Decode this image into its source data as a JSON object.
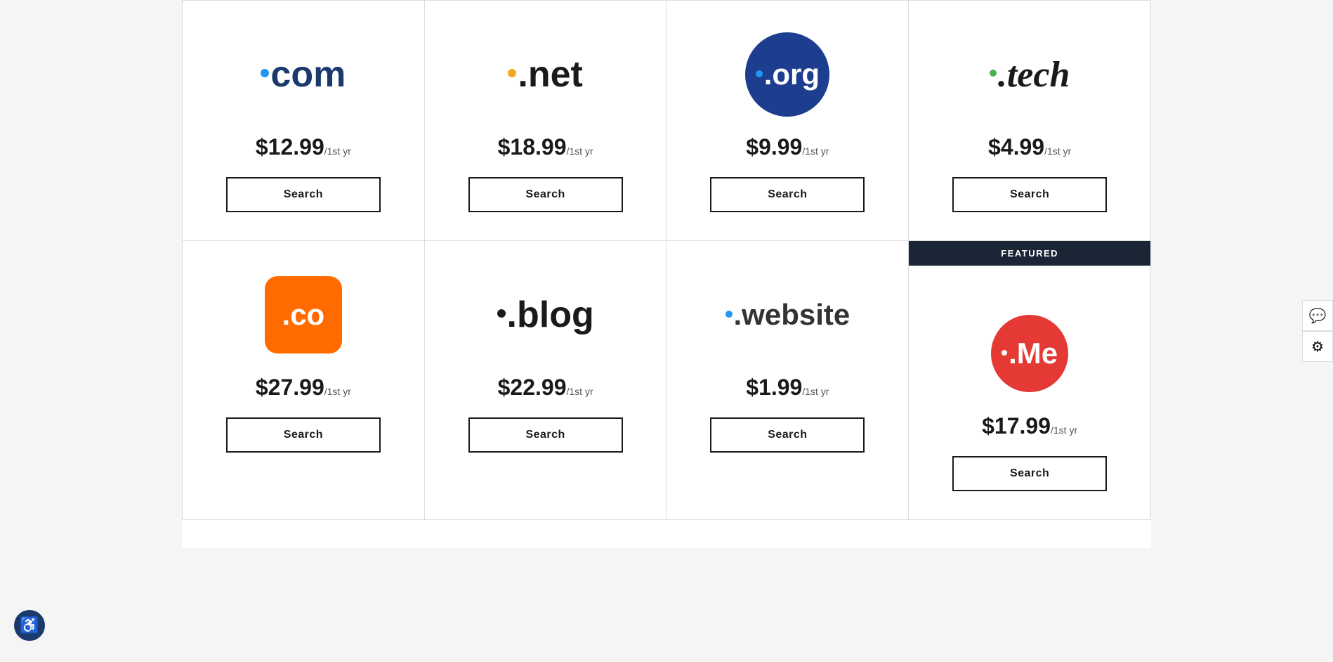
{
  "domains": {
    "row1": [
      {
        "name": "com",
        "type": "com",
        "price": "$12.99",
        "period": "/1st yr",
        "search_label": "Search",
        "featured": false
      },
      {
        "name": "net",
        "type": "net",
        "price": "$18.99",
        "period": "/1st yr",
        "search_label": "Search",
        "featured": false
      },
      {
        "name": "org",
        "type": "org",
        "price": "$9.99",
        "period": "/1st yr",
        "search_label": "Search",
        "featured": false
      },
      {
        "name": "tech",
        "type": "tech",
        "price": "$4.99",
        "period": "/1st yr",
        "search_label": "Search",
        "featured": false
      }
    ],
    "row2": [
      {
        "name": "co",
        "type": "co",
        "price": "$27.99",
        "period": "/1st yr",
        "search_label": "Search",
        "featured": false
      },
      {
        "name": "blog",
        "type": "blog",
        "price": "$22.99",
        "period": "/1st yr",
        "search_label": "Search",
        "featured": false
      },
      {
        "name": "website",
        "type": "website",
        "price": "$1.99",
        "period": "/1st yr",
        "search_label": "Search",
        "featured": false
      },
      {
        "name": "me",
        "type": "me",
        "price": "$17.99",
        "period": "/1st yr",
        "search_label": "Search",
        "featured": true,
        "featured_label": "FEATURED"
      }
    ]
  },
  "accessibility": {
    "label": "Accessibility"
  },
  "right_widget": {
    "chat_icon": "💬",
    "settings_icon": "⚙"
  }
}
